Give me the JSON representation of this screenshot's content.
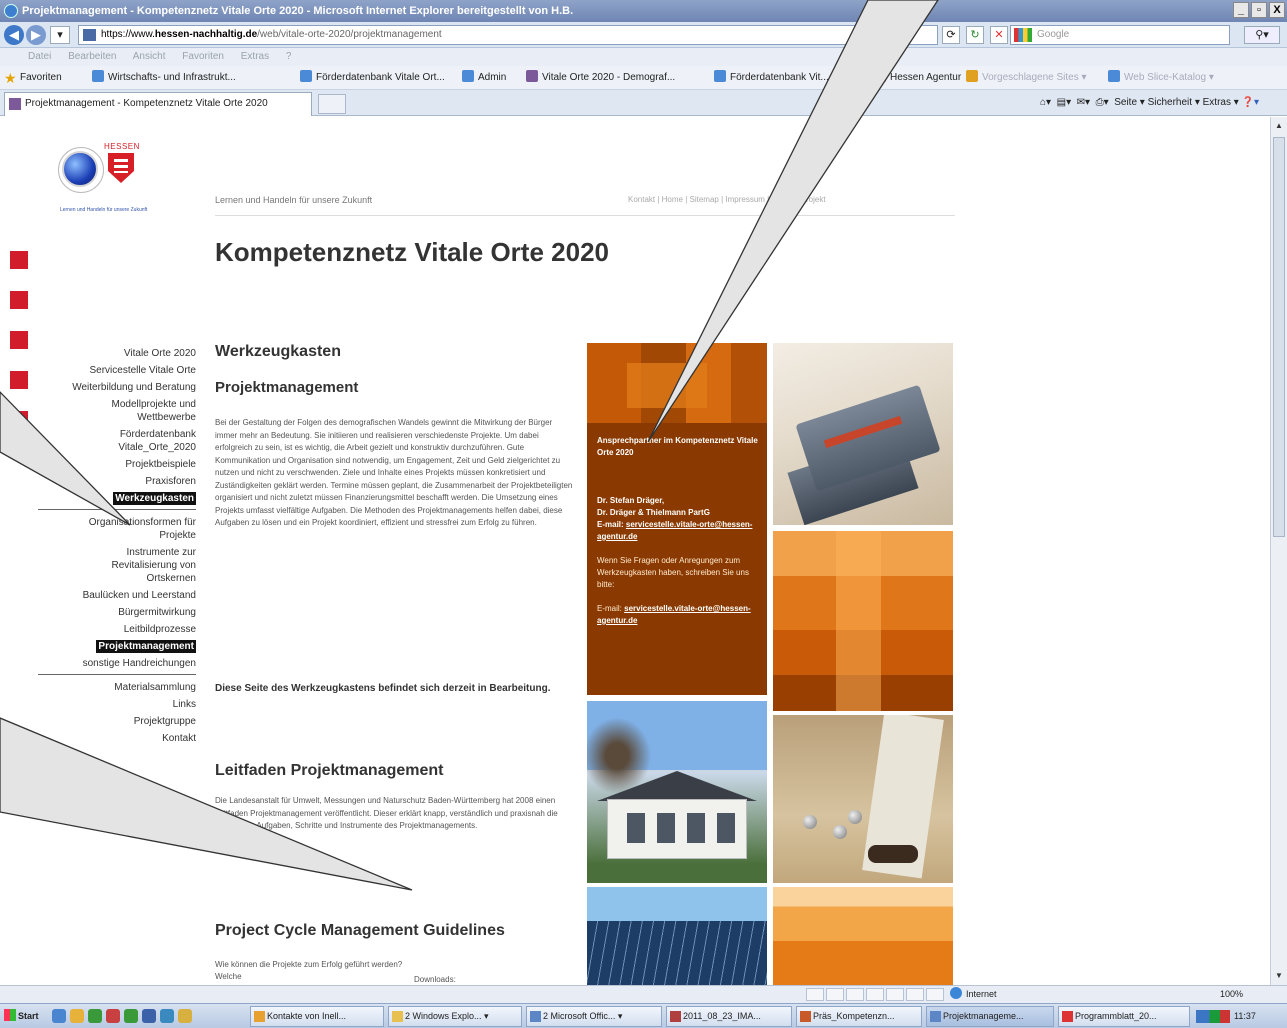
{
  "window": {
    "title": "Projektmanagement - Kompetenznetz Vitale Orte 2020 - Microsoft Internet Explorer bereitgestellt von H.B.",
    "controls": [
      "_",
      "▫",
      "X"
    ]
  },
  "address": {
    "url_prefix": "https://www.",
    "url_site": "hessen-nachhaltig.de",
    "url_path": "/web/vitale-orte-2020/projektmanagement",
    "search_placeholder": "Google"
  },
  "menubar": "Datei Bearbeiten Ansicht Favoriten Extras ?",
  "favorites": {
    "label": "Favoriten",
    "items": [
      "Wirtschafts- und Infrastrukt...",
      "Förderdatenbank Vitale Ort...",
      "Admin",
      "Vitale Orte 2020 - Demograf...",
      "Förderdatenbank Vit...",
      "Hessen Agentur",
      "Vorgeschlagene Sites ▾",
      "Web Slice-Katalog ▾"
    ]
  },
  "tab": {
    "label": "Projektmanagement - Kompetenznetz Vitale Orte 2020",
    "commands": "Seite ▾  Sicherheit ▾  Extras ▾"
  },
  "page": {
    "logo_hessen": "HESSEN",
    "logo_tagline": "Lernen und Handeln für unsere Zukunft",
    "tagline": "Lernen und Handeln für unsere Zukunft",
    "topnav": "Kontakt | Home | Sitemap | Impressum | Suche | Projekt",
    "title": "Kompetenznetz Vitale Orte 2020",
    "sidenav": [
      "Vitale Orte 2020",
      "Servicestelle Vitale Orte",
      "Weiterbildung und Beratung",
      "Modellprojekte und Wettbewerbe",
      "Förderdatenbank Vitale_Orte_2020",
      "Projektbeispiele",
      "Praxisforen",
      "Werkzeugkasten",
      "Organisationsformen für Projekte",
      "Instrumente zur Revitalisierung von Ortskernen",
      "Baulücken und Leerstand",
      "Bürgermitwirkung",
      "Leitbildprozesse",
      "Projektmanagement",
      "sonstige Handreichungen",
      "Materialsammlung",
      "Links",
      "Projektgruppe",
      "Kontakt"
    ],
    "h_werkzeug": "Werkzeugkasten",
    "h_proj": "Projektmanagement",
    "intro": "Bei der Gestaltung der Folgen des demografischen Wandels gewinnt die Mitwirkung der Bürger immer mehr an Bedeutung. Sie initiieren und realisieren verschiedenste Projekte. Um dabei erfolgreich zu sein, ist es wichtig, die Arbeit gezielt und konstruktiv durchzuführen. Gute Kommunikation und Organisation sind notwendig, um Engagement, Zeit und Geld zielgerichtet zu nutzen und nicht zu verschwenden. Ziele und Inhalte eines Projekts müssen konkretisiert und Zuständigkeiten geklärt werden. Termine müssen geplant, die Zusammenarbeit der Projektbeteiligten organisiert und nicht zuletzt müssen Finanzierungsmittel beschafft werden. Die Umsetzung eines Projekts umfasst vielfältige Aufgaben. Die Methoden des Projektmanagements helfen dabei, diese Aufgaben zu lösen und ein Projekt koordiniert, effizient und stressfrei zum Erfolg zu führen.",
    "status": "Diese Seite des Werkzeugkastens befindet sich derzeit in Bearbeitung.",
    "h_leitfaden": "Leitfaden Projektmanagement",
    "leitfaden": "Die Landesanstalt für Umwelt, Messungen und Naturschutz Baden-Württemberg hat 2008 einen Leitfaden Projektmanagement veröffentlicht. Dieser erklärt knapp, verständlich und praxisnah die wichtigsten Aufgaben, Schritte und Instrumente des Projektmanagements.",
    "leitfaden_link_prefix": ">> ",
    "leitfaden_link": "zum Leitfaden",
    "h_pcm": "Project Cycle Management Guidelines",
    "pcm": "Wie können die Projekte zum Erfolg geführt werden? Welche",
    "downloads": "Downloads:",
    "contact": {
      "heading": "Ansprechpartner im Kompetenznetz Vitale Orte 2020",
      "name": "Dr. Stefan Dräger,",
      "org": "Dr. Dräger & Thielmann PartG",
      "email_label": "E-mail: ",
      "email": "servicestelle.vitale-orte@hessen-agentur.de",
      "note": "Wenn Sie Fragen oder Anregungen zum Werkzeugkasten haben, schreiben Sie uns bitte:",
      "email2_label": "E-mail: ",
      "email2": "servicestelle.vitale-orte@hessen-agentur.de"
    }
  },
  "statusbar": {
    "zone": "Internet",
    "zoom": "100%"
  },
  "taskbar": {
    "start": "Start",
    "tasks": [
      "Kontakte von Inell...",
      "2 Windows Explo... ▾",
      "2 Microsoft Offic... ▾",
      "2011_08_23_IMA...",
      "Präs_Kompetenzn...",
      "Projektmanageme...",
      "Programmblatt_20..."
    ],
    "clock": "11:37"
  },
  "colors": {
    "accent_red": "#d11c2c",
    "contact_bg": "#8a3a00",
    "link_highlight": "#111111"
  }
}
